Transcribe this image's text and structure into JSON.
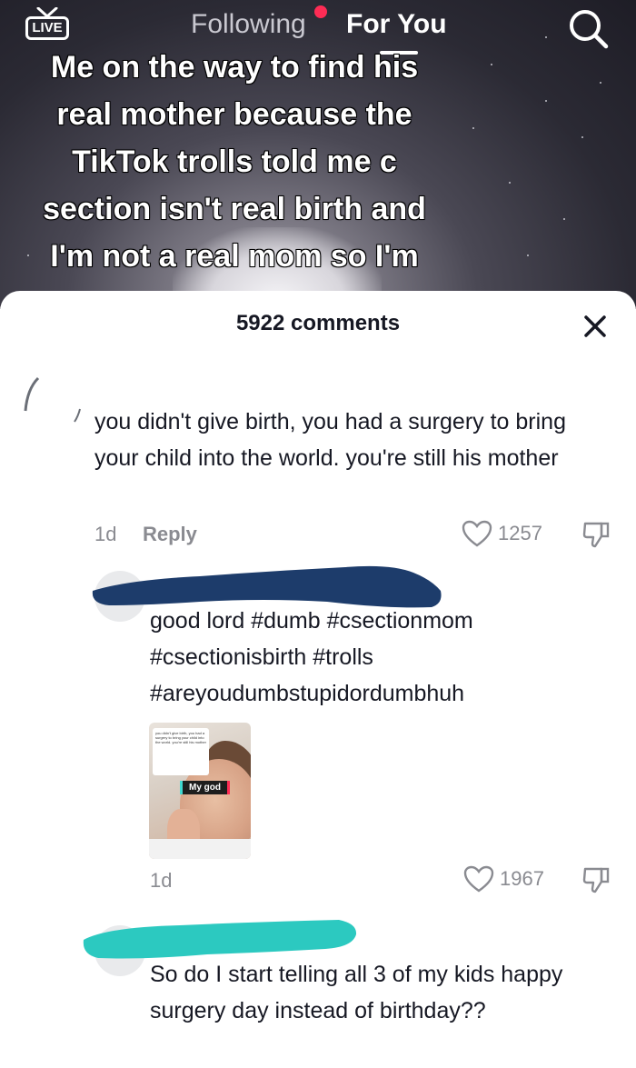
{
  "top_nav": {
    "live_label": "LIVE",
    "following_label": "Following",
    "for_you_label": "For You",
    "notification_dot_color": "#fe2c55",
    "search_icon": "search-icon"
  },
  "video": {
    "caption_lines": [
      "Me on the way to find his",
      "real mother because the",
      "TikTok trolls told me c",
      "section isn't real birth and",
      "I'm not a real mom so I'm"
    ]
  },
  "comments_sheet": {
    "title": "5922 comments",
    "close_icon": "close-icon",
    "comments": [
      {
        "text": "you didn't give birth, you had a surgery to bring your child into the world. you're still his mother",
        "time": "1d",
        "reply_label": "Reply",
        "likes": "1257"
      },
      {
        "text": "good lord #dumb #csectionmom #csectionisbirth #trolls #areyoudumbstupidordumbhuh",
        "thumbnail_label": "My god",
        "thumbnail_sticker": "you didn't give birth, you had a surgery to bring your child into the world. you're still his mother",
        "time": "1d",
        "likes": "1967",
        "redaction_color": "#1d3c6b"
      },
      {
        "text": "So do I start telling all 3 of my kids happy surgery day instead of birthday??",
        "redaction_color": "#2cc9c0"
      }
    ]
  }
}
